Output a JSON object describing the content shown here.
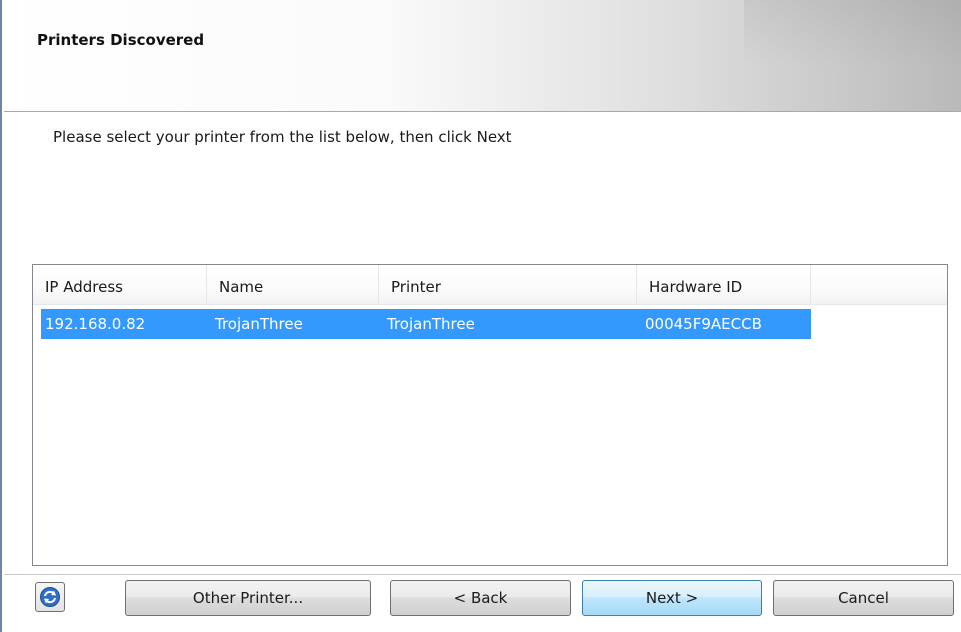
{
  "header": {
    "title": "Printers Discovered"
  },
  "instructions": "Please select your printer from the list below, then click Next",
  "table": {
    "columns": [
      "IP Address",
      "Name",
      "Printer",
      "Hardware ID"
    ],
    "rows": [
      {
        "ip": "192.168.0.82",
        "name": "TrojanThree",
        "printer": "TrojanThree",
        "hardware_id": "00045F9AECCB",
        "selected": true
      }
    ]
  },
  "buttons": {
    "refresh_icon": "refresh-icon",
    "other_printer": "Other Printer...",
    "back": "< Back",
    "next": "Next >",
    "cancel": "Cancel"
  },
  "colors": {
    "selection": "#3399ff",
    "border": "#6d86a8"
  }
}
